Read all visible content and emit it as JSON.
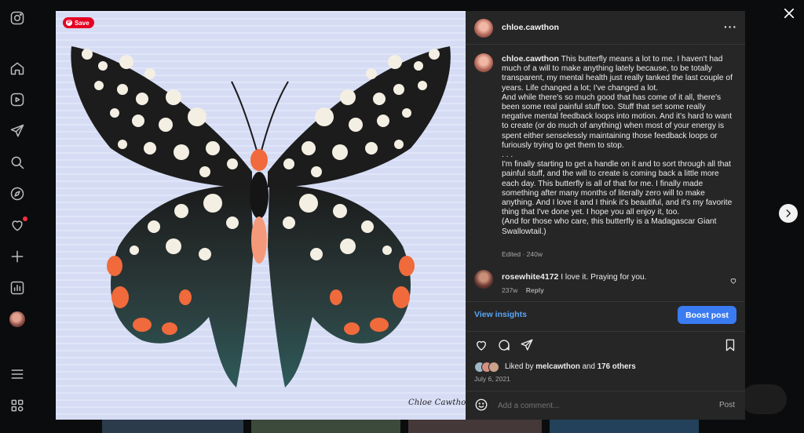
{
  "rail": {
    "icons": [
      "instagram-icon",
      "home-icon",
      "reels-icon",
      "messages-icon",
      "search-icon",
      "explore-icon",
      "notifications-icon",
      "create-icon",
      "dashboard-icon",
      "profile-avatar",
      "menu-icon",
      "more-icon"
    ]
  },
  "photo": {
    "save_label": "Save",
    "signature": "Chloe Cawthon"
  },
  "header": {
    "username": "chloe.cawthon"
  },
  "caption": {
    "username": "chloe.cawthon",
    "paragraph1": "This butterfly means a lot to me. I haven't had much of a will to make anything lately because, to be totally transparent, my mental health just really tanked the last couple of years. Life changed a lot; I've changed a lot.",
    "paragraph2": "And while there's so much good that has come of it all, there's been some real painful stuff too. Stuff that set some really negative mental feedback loops into motion. And it's hard to want to create (or do much of anything) when most of your energy is spent either senselessly maintaining those feedback loops or furiously trying to get them to stop.",
    "ellipsis": ". . .",
    "paragraph3": "I'm finally starting to get a handle on it and to sort through all that painful stuff, and the will to create is coming back a little more each day. This butterfly is all of that for me. I finally made something after many months of literally zero will to make anything. And I love it and I think it's beautiful, and it's my favorite thing that I've done yet. I hope you all enjoy it, too.",
    "paragraph4": "(And for those who care, this butterfly is a Madagascar Giant Swallowtail.)",
    "meta": "Edited · 240w"
  },
  "comment": {
    "username": "rosewhite4172",
    "text": "I love it. Praying for you.",
    "age": "237w",
    "reply_label": "Reply"
  },
  "actions": {
    "insights_label": "View insights",
    "boost_label": "Boost post"
  },
  "likes": {
    "prefix": "Liked by",
    "user": "melcawthon",
    "and": "and",
    "others": "176 others"
  },
  "date": "July 6, 2021",
  "composer": {
    "placeholder": "Add a comment...",
    "post_label": "Post"
  },
  "colors": {
    "accent": "#3a7bf2",
    "link": "#5aa6f5",
    "pinterest": "#e60023",
    "panel": "#262626"
  }
}
